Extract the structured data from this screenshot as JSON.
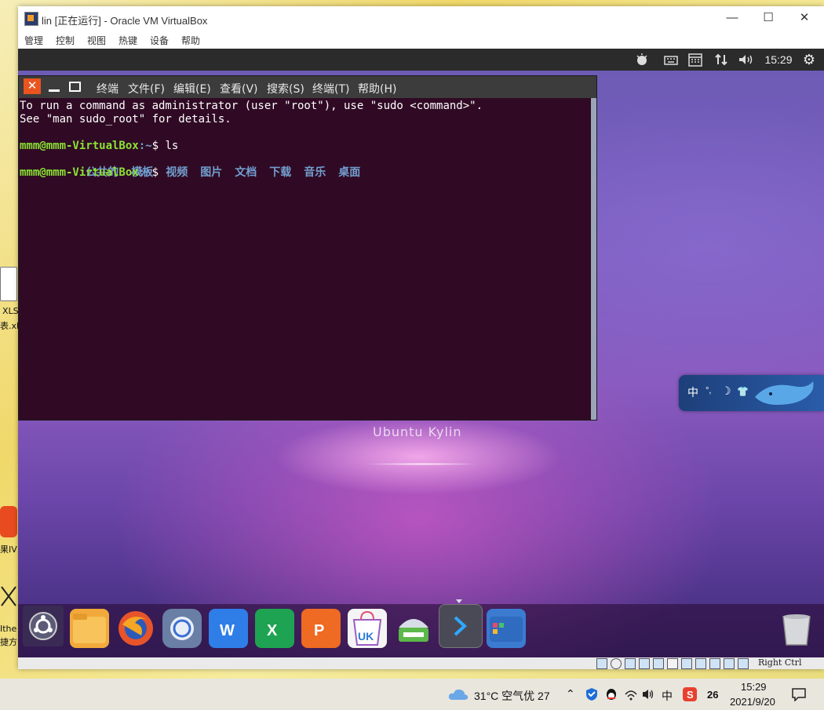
{
  "host": {
    "left_icons": {
      "xls_line1": "XLS",
      "xls_line2": "表.xl",
      "app_line": "果IV",
      "bottom_line1": "Ithe",
      "bottom_line2": "捷方"
    }
  },
  "vbox": {
    "title": "lin [正在运行] - Oracle VM VirtualBox",
    "menu": [
      "管理",
      "控制",
      "视图",
      "热键",
      "设备",
      "帮助"
    ],
    "status_right": "Right Ctrl"
  },
  "guest": {
    "panel": {
      "time": "15:29"
    },
    "wallpaper_label": "Ubuntu Kylin",
    "terminal": {
      "menu": [
        "终端",
        "文件(F)",
        "编辑(E)",
        "查看(V)",
        "搜索(S)",
        "终端(T)",
        "帮助(H)"
      ],
      "lines": [
        "To run a command as administrator (user \"root\"), use \"sudo <command>\".",
        "See \"man sudo_root\" for details."
      ],
      "prompt_user": "mmm@mmm-VirtualBox",
      "prompt_path": ":~",
      "prompt_sign": "$ ",
      "command": "ls",
      "dirs": [
        "公共的",
        "模板",
        "视频",
        "图片",
        "文档",
        "下载",
        "音乐",
        "桌面"
      ]
    },
    "ime": {
      "mode": "中",
      "punct": "°,",
      "moon": "☽",
      "shirt": "👕"
    },
    "dock_icons": [
      "ukui-menu-icon",
      "file-manager-icon",
      "firefox-icon",
      "chromium-icon",
      "wps-writer-icon",
      "wps-spreadsheet-icon",
      "wps-presentation-icon",
      "software-center-icon",
      "scanner-icon",
      "terminal-icon",
      "multitasking-icon",
      "trash-icon"
    ]
  },
  "taskbar": {
    "weather": "31°C 空气优 27",
    "ime": "中",
    "badge": "26",
    "time": "15:29",
    "date": "2021/9/20"
  }
}
